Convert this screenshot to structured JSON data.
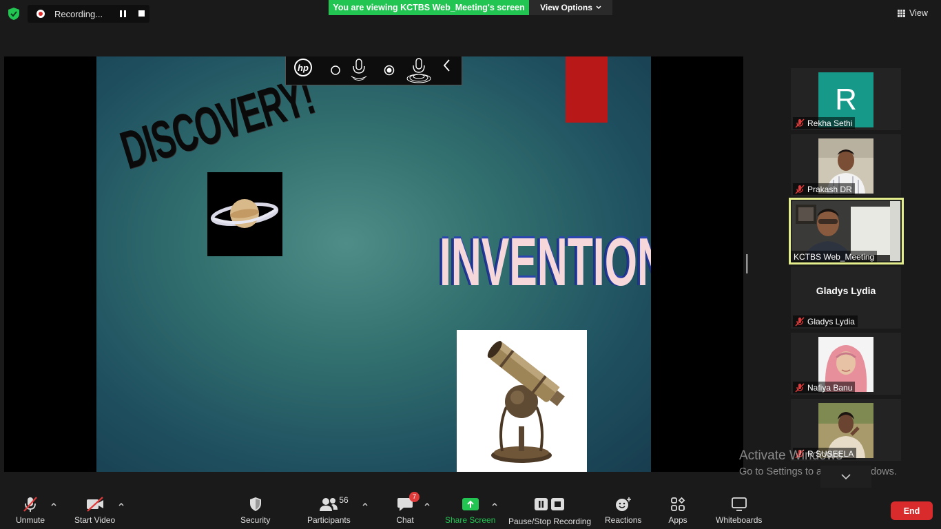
{
  "topbar": {
    "recording_label": "Recording...",
    "viewing_banner": "You are viewing KCTBS Web_Meeting's screen",
    "view_options_label": "View Options",
    "view_label": "View"
  },
  "slide": {
    "discovery_text": "DISCOVERY!",
    "invention_text": "INVENTION"
  },
  "participants": [
    {
      "name": "Rekha Sethi",
      "avatar_letter": "R"
    },
    {
      "name": "Prakash DR"
    },
    {
      "name": "KCTBS Web_Meeting",
      "active": true
    },
    {
      "name": "Gladys Lydia",
      "display_name": "Gladys Lydia"
    },
    {
      "name": "Nafiya Banu"
    },
    {
      "name": "R SUSEELA"
    }
  ],
  "watermark": {
    "line1": "Activate Windows",
    "line2": "Go to Settings to activate Windows."
  },
  "toolbar": {
    "unmute": "Unmute",
    "start_video": "Start Video",
    "security": "Security",
    "participants": "Participants",
    "participants_count": "56",
    "chat": "Chat",
    "chat_badge": "7",
    "share_screen": "Share Screen",
    "pause_stop_recording": "Pause/Stop Recording",
    "reactions": "Reactions",
    "apps": "Apps",
    "whiteboards": "Whiteboards",
    "end": "End"
  },
  "colors": {
    "accent_green": "#23c552",
    "end_red": "#d92b2b",
    "active_speaker_border": "#e4ee8c",
    "avatar_teal": "#17998a"
  }
}
